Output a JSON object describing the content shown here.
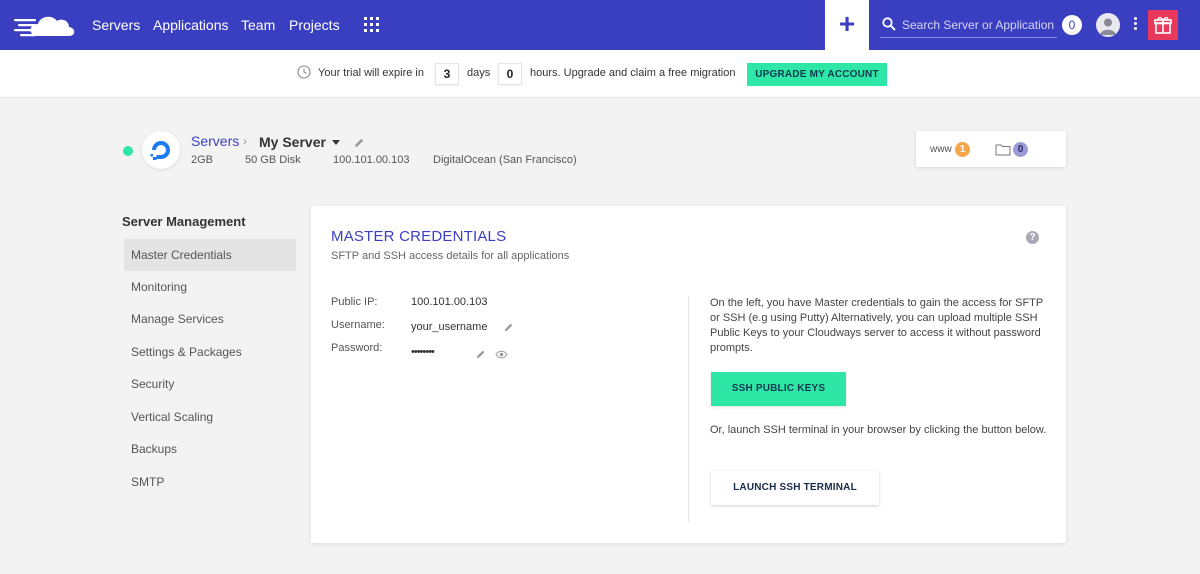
{
  "nav": {
    "links": [
      "Servers",
      "Applications",
      "Team",
      "Projects"
    ],
    "add_label": "+",
    "search_placeholder": "Search Server or Application",
    "notification_count": "0",
    "icons": {
      "logo": "cloudways-logo-icon",
      "apps": "apps-grid-icon",
      "search": "search-icon",
      "avatar": "user-avatar-icon",
      "more": "kebab-menu-icon",
      "gift": "gift-icon"
    },
    "colors": {
      "nav_bg": "#3a3fc2",
      "gift_bg": "#e8395d"
    }
  },
  "trial": {
    "prefix": "Your trial will expire in",
    "days": "3",
    "days_label": "days",
    "hours": "0",
    "suffix": "hours. Upgrade and claim a free migration",
    "button": "UPGRADE MY ACCOUNT",
    "accent": "#2ee6a6"
  },
  "server": {
    "status": "online",
    "breadcrumb_root": "Servers",
    "breadcrumb_sep": "›",
    "name": "My Server",
    "ram": "2GB",
    "disk": "50 GB Disk",
    "ip": "100.101.00.103",
    "provider": "DigitalOcean (San Francisco)",
    "www_label": "www",
    "www_count": "1",
    "files_count": "0"
  },
  "sidebar": {
    "title": "Server Management",
    "items": [
      {
        "label": "Master Credentials",
        "active": true
      },
      {
        "label": "Monitoring"
      },
      {
        "label": "Manage Services"
      },
      {
        "label": "Settings & Packages"
      },
      {
        "label": "Security"
      },
      {
        "label": "Vertical Scaling"
      },
      {
        "label": "Backups"
      },
      {
        "label": "SMTP"
      }
    ]
  },
  "credentials": {
    "title": "MASTER CREDENTIALS",
    "subtitle": "SFTP and SSH access details for all applications",
    "help": "?",
    "public_ip_label": "Public IP:",
    "public_ip": "100.101.00.103",
    "username_label": "Username:",
    "username": "your_username",
    "password_label": "Password:",
    "password": "••••••••",
    "info": "On the left, you have Master credentials to gain the access for SFTP or SSH (e.g using Putty) Alternatively, you can upload multiple SSH Public Keys to your Cloudways server to access it without password prompts.",
    "ssh_keys_button": "SSH PUBLIC KEYS",
    "terminal_text": "Or, launch SSH terminal in your browser by clicking the button below.",
    "terminal_button": "LAUNCH SSH TERMINAL"
  }
}
